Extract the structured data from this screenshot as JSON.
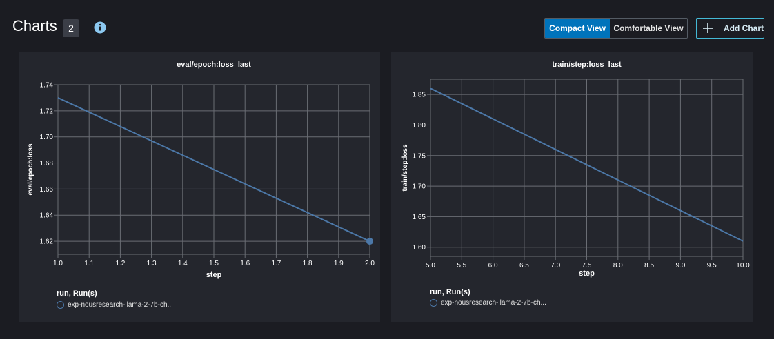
{
  "header": {
    "title": "Charts",
    "count": "2",
    "view_modes": [
      "Compact View",
      "Comfortable View"
    ],
    "active_view": "Compact View",
    "add_chart_label": "Add Chart"
  },
  "colors": {
    "background": "#1b1c22",
    "panel": "#24262d",
    "series": "#4c78a8",
    "accent": "#0073bb",
    "grid": "#6a6d74"
  },
  "panels": [
    {
      "legend_title": "run, Run(s)",
      "legend_item": "exp-nousresearch-llama-2-7b-ch..."
    },
    {
      "legend_title": "run, Run(s)",
      "legend_item": "exp-nousresearch-llama-2-7b-ch..."
    }
  ],
  "chart_data": [
    {
      "type": "line",
      "title": "eval/epoch:loss_last",
      "xlabel": "step",
      "ylabel": "eval/epoch:loss",
      "xlim": [
        1.0,
        2.0
      ],
      "ylim": [
        1.61,
        1.74
      ],
      "xticks": [
        "1.0",
        "1.1",
        "1.2",
        "1.3",
        "1.4",
        "1.5",
        "1.6",
        "1.7",
        "1.8",
        "1.9",
        "2.0"
      ],
      "yticks": [
        "1.62",
        "1.64",
        "1.66",
        "1.68",
        "1.70",
        "1.72",
        "1.74"
      ],
      "grid": true,
      "series": [
        {
          "x": [
            1.0,
            2.0
          ],
          "y": [
            1.73,
            1.62
          ],
          "end_marker": true
        }
      ]
    },
    {
      "type": "line",
      "title": "train/step:loss_last",
      "xlabel": "step",
      "ylabel": "train/step:loss",
      "xlim": [
        5.0,
        10.0
      ],
      "ylim": [
        1.585,
        1.875
      ],
      "xticks": [
        "5.0",
        "5.5",
        "6.0",
        "6.5",
        "7.0",
        "7.5",
        "8.0",
        "8.5",
        "9.0",
        "9.5",
        "10.0"
      ],
      "yticks": [
        "1.60",
        "1.65",
        "1.70",
        "1.75",
        "1.80",
        "1.85"
      ],
      "grid": true,
      "series": [
        {
          "x": [
            5.0,
            10.0
          ],
          "y": [
            1.86,
            1.61
          ],
          "end_marker": false
        }
      ]
    }
  ]
}
